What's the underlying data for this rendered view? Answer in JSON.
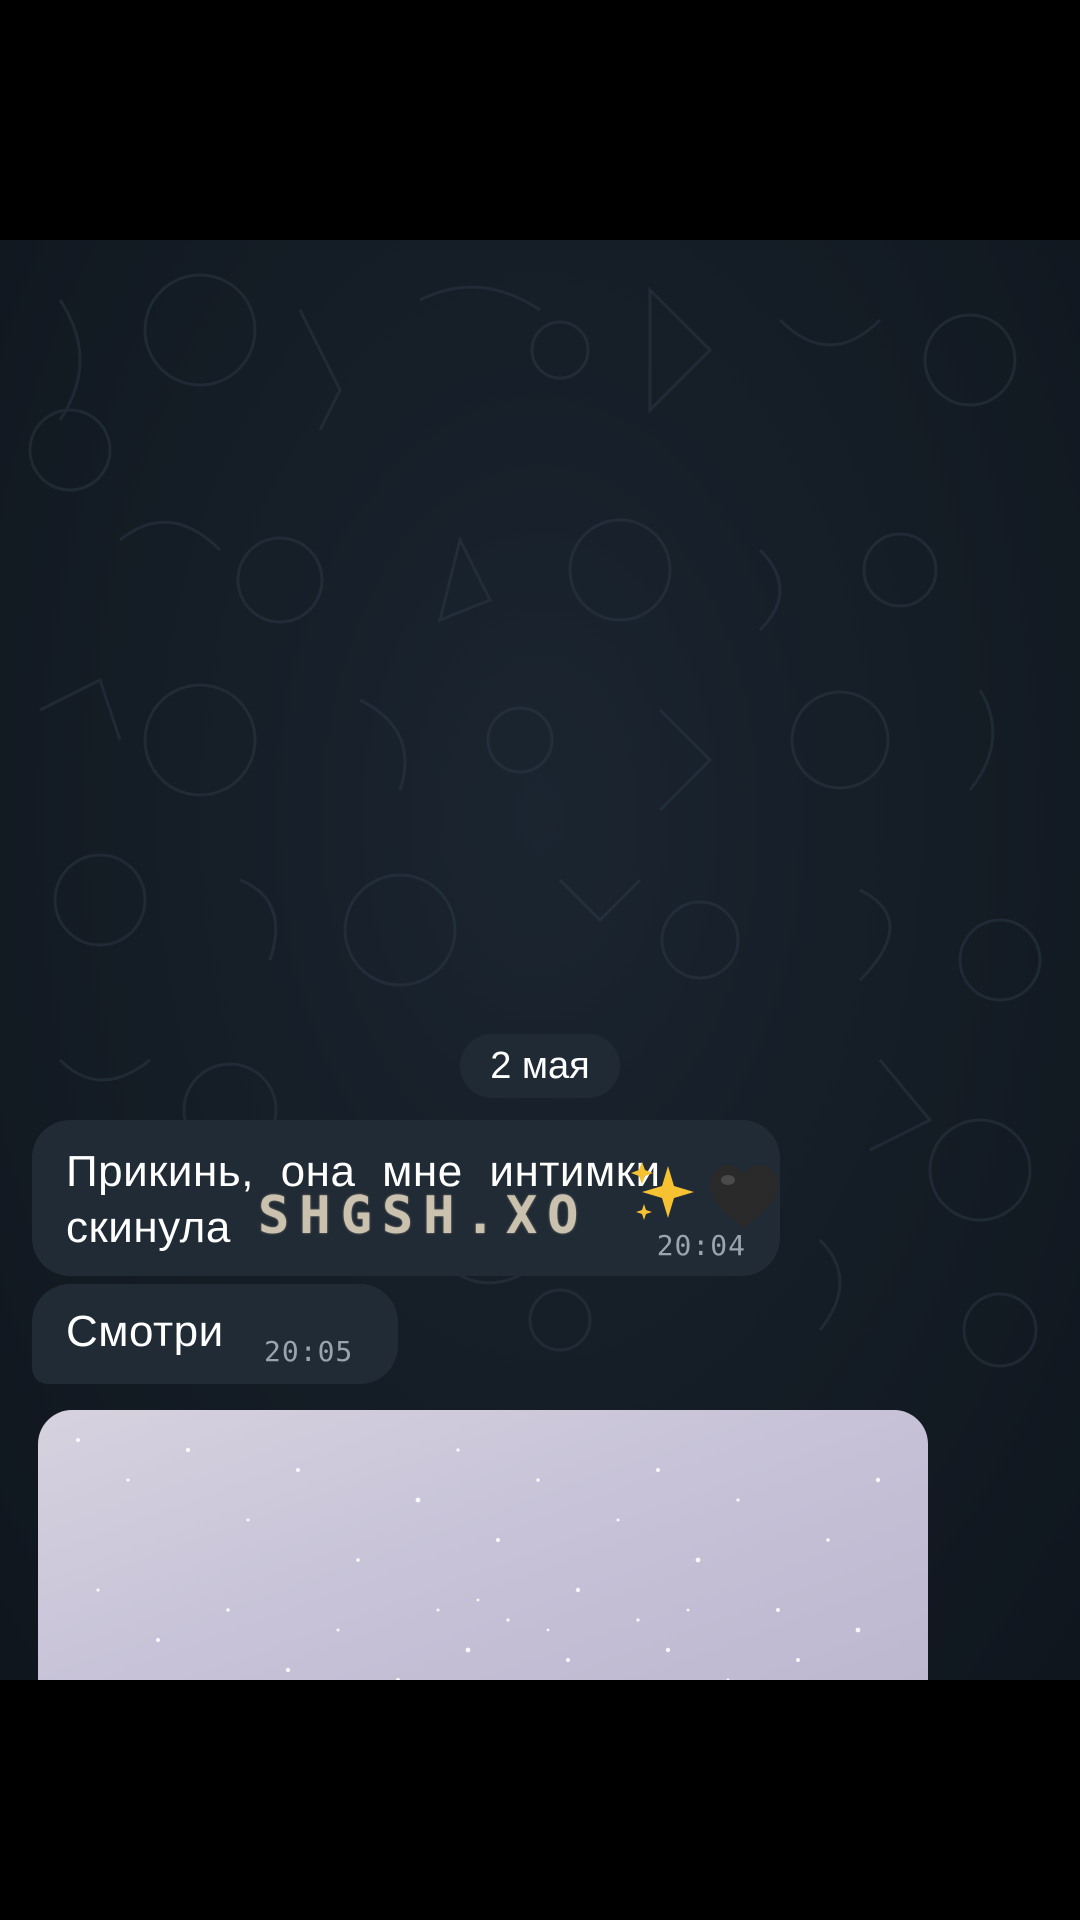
{
  "chat": {
    "date_separator": "2 мая",
    "messages": [
      {
        "text": "Прикинь, она мне интимки скинула",
        "time": "20:04"
      },
      {
        "text": "Смотри",
        "time": "20:05"
      }
    ]
  },
  "overlay": {
    "watermark": "SHGSH.XO",
    "emojis": [
      "sparkles-icon",
      "black-heart-icon"
    ]
  },
  "colors": {
    "background": "#141c25",
    "bubble": "#212b36",
    "time_text": "#9aa4ae",
    "photo": "#c8c3d8",
    "watermark": "#e8dcc4"
  }
}
